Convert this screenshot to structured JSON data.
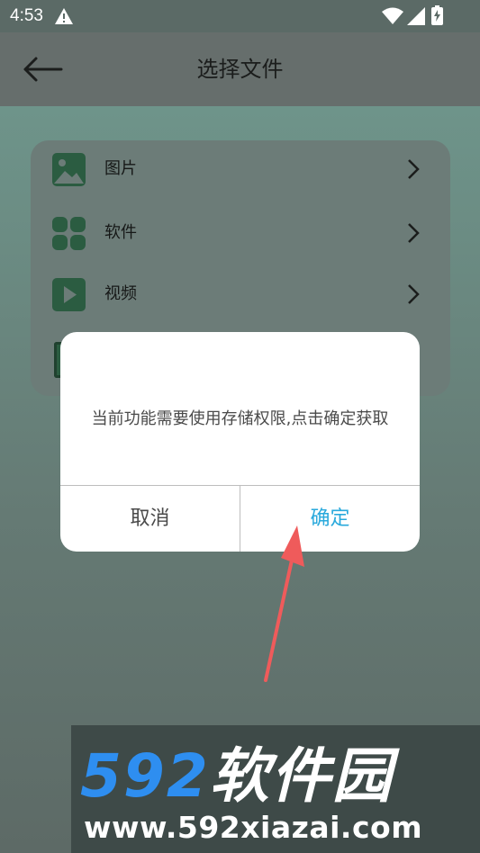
{
  "status_bar": {
    "time": "4:53",
    "icons": [
      "warning-icon",
      "wifi-icon",
      "signal-icon",
      "battery-charging-icon"
    ]
  },
  "header": {
    "title": "选择文件",
    "back_icon": "arrow-left-icon"
  },
  "file_types": [
    {
      "label": "图片",
      "icon": "image-icon"
    },
    {
      "label": "软件",
      "icon": "apps-icon"
    },
    {
      "label": "视频",
      "icon": "play-icon"
    }
  ],
  "dialog": {
    "message": "当前功能需要使用存储权限,点击确定获取",
    "cancel_label": "取消",
    "confirm_label": "确定"
  },
  "watermark": {
    "logo_number": "592",
    "logo_text": "软件园",
    "url": "www.592xiazai.com"
  },
  "colors": {
    "accent": "#29a9dc",
    "icon_green": "#2b5c41",
    "arrow_red": "#ef5b5b",
    "logo_blue": "#2e8ef0"
  }
}
